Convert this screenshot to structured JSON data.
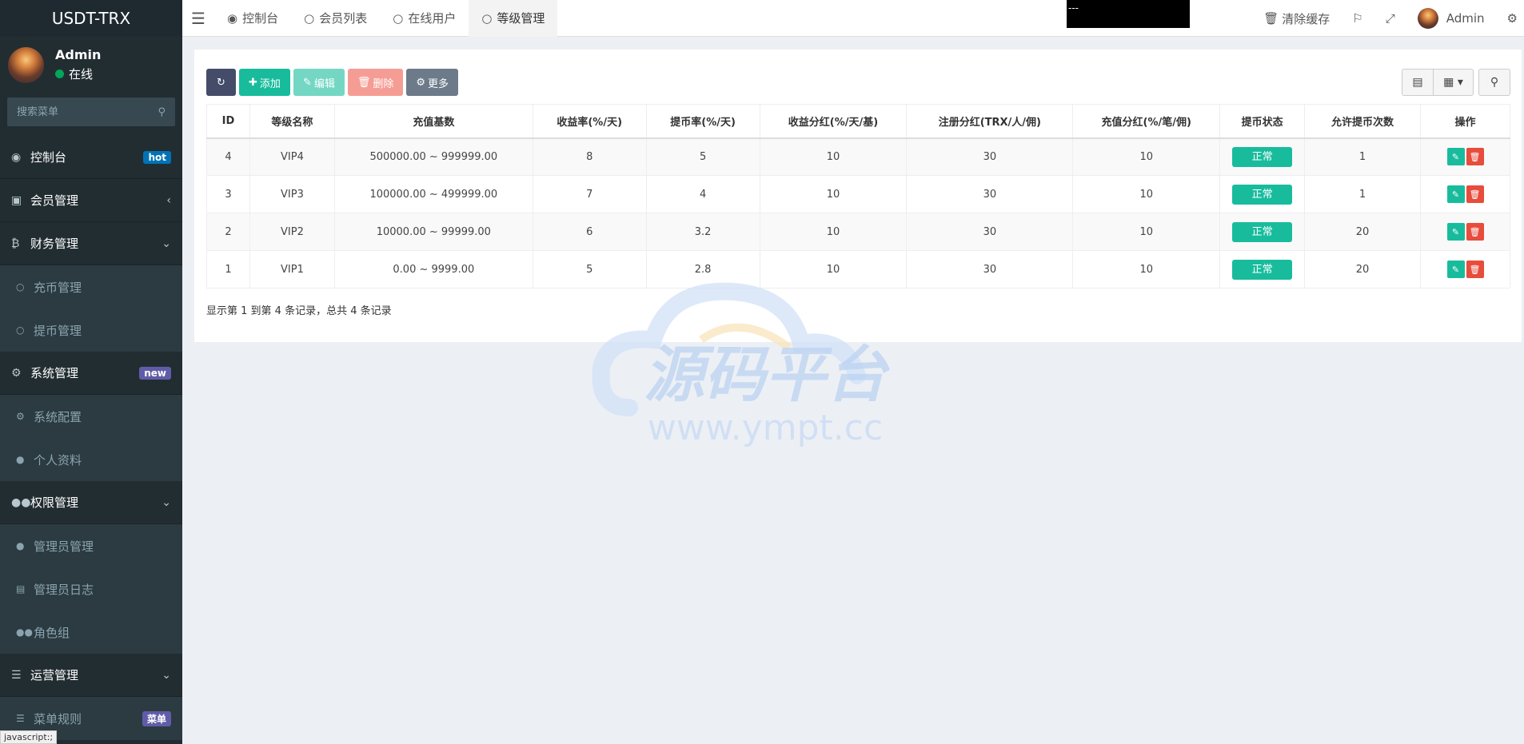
{
  "sidebar": {
    "logo": "USDT-TRX",
    "user": {
      "name": "Admin",
      "status": "在线"
    },
    "search_placeholder": "搜索菜单",
    "menu": [
      {
        "label": "控制台",
        "icon": "dashboard-icon",
        "badge": "hot",
        "badge_color": "#0073b7"
      },
      {
        "label": "会员管理",
        "icon": "user-card-icon",
        "caret": "‹"
      },
      {
        "label": "财务管理",
        "icon": "bitcoin-icon",
        "caret": "⌄",
        "children": [
          "充币管理",
          "提币管理"
        ]
      },
      {
        "label": "系统管理",
        "icon": "cogs-icon",
        "badge": "new",
        "badge_color": "#605ca8",
        "children": [
          "系统配置",
          "个人资料"
        ]
      },
      {
        "label": "权限管理",
        "icon": "group-icon",
        "caret": "⌄",
        "children": [
          "管理员管理",
          "管理员日志",
          "角色组"
        ]
      },
      {
        "label": "运营管理",
        "icon": "list-icon",
        "caret": "⌄",
        "children": [
          "菜单规则"
        ]
      }
    ],
    "last_badge": "菜单",
    "status_url": "javascript:;"
  },
  "header": {
    "tabs": [
      {
        "label": "控制台",
        "icon": "dashboard-icon"
      },
      {
        "label": "会员列表",
        "icon": "circle-icon"
      },
      {
        "label": "在线用户",
        "icon": "circle-icon"
      },
      {
        "label": "等级管理",
        "icon": "circle-icon"
      }
    ],
    "black_box_text": "---",
    "clear_cache": "清除缓存",
    "admin": "Admin"
  },
  "toolbar": {
    "add": "添加",
    "edit": "编辑",
    "delete": "删除",
    "more": "更多"
  },
  "table": {
    "headers": [
      "ID",
      "等级名称",
      "充值基数",
      "收益率(%/天)",
      "提币率(%/天)",
      "收益分红(%/天/基)",
      "注册分红(TRX/人/佣)",
      "充值分红(%/笔/佣)",
      "提币状态",
      "允许提币次数",
      "操作"
    ],
    "rows": [
      [
        "4",
        "VIP4",
        "500000.00 ~ 999999.00",
        "8",
        "5",
        "10",
        "30",
        "10",
        "正常",
        "1"
      ],
      [
        "3",
        "VIP3",
        "100000.00 ~ 499999.00",
        "7",
        "4",
        "10",
        "30",
        "10",
        "正常",
        "1"
      ],
      [
        "2",
        "VIP2",
        "10000.00 ~ 99999.00",
        "6",
        "3.2",
        "10",
        "30",
        "10",
        "正常",
        "20"
      ],
      [
        "1",
        "VIP1",
        "0.00 ~ 9999.00",
        "5",
        "2.8",
        "10",
        "30",
        "10",
        "正常",
        "20"
      ]
    ]
  },
  "pager_text": "显示第 1 到第 4 条记录，总共 4 条记录",
  "watermark": {
    "cn": "源码平台",
    "url": "www.ympt.cc"
  },
  "colors": {
    "accent": "#18bc9c",
    "sidebar": "#222d32",
    "danger": "#e74c3c"
  }
}
